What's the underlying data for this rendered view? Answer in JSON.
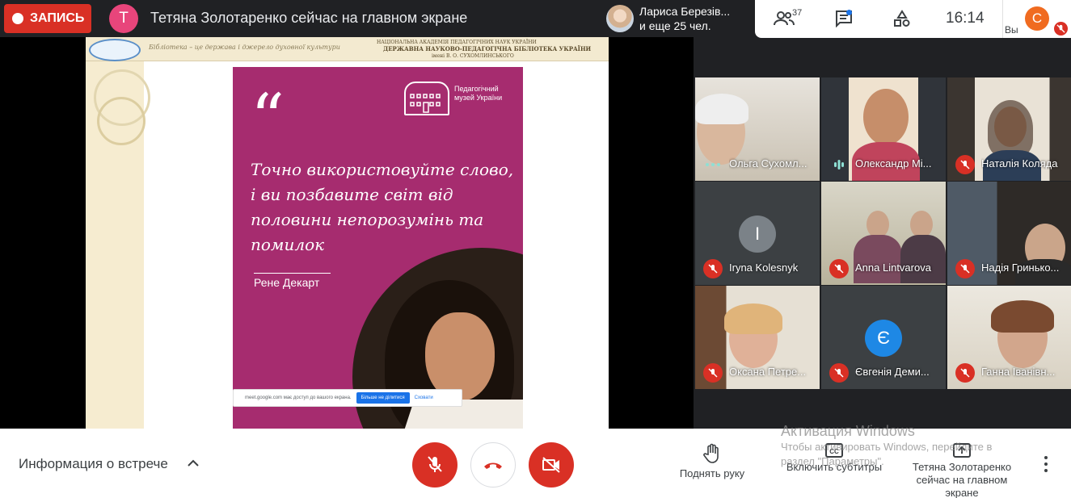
{
  "recording": {
    "label": "ЗАПИСЬ",
    "color": "#d93025"
  },
  "presenter": {
    "initial": "Т",
    "avatar_color": "#e8457b",
    "status": "Тетяна Золотаренко сейчас на главном экране"
  },
  "attendees": {
    "name": "Лариса Березів...",
    "more": "и еще 25 чел."
  },
  "toolbar": {
    "people_icon": "people-icon",
    "people_count": "37",
    "chat_icon": "chat-icon",
    "activities_icon": "activities-icon",
    "time": "16:14",
    "self_initial": "С",
    "self_avatar_color": "#f06b20",
    "self_label": "Вы"
  },
  "slide": {
    "slogan": "Бібліотека – це держава і джерело духовної культури",
    "academy_line1": "НАЦІОНАЛЬНА АКАДЕМІЯ ПЕДАГОГІЧНИХ НАУК УКРАЇНИ",
    "academy_line2": "ДЕРЖАВНА НАУКОВО-ПЕДАГОГІЧНА БІБЛІОТЕКА УКРАЇНИ",
    "academy_line3": "імені В. О. СУХОМЛИНСЬКОГО",
    "museum_name": "Педагогічний музей України",
    "quote_marks": "“",
    "quote": "Точно використовуйте слово, і ви позбавите світ від половини непорозумінь та помилок",
    "author": "Рене Декарт",
    "card_color": "#a62c6f"
  },
  "share_bar": {
    "text": "meet.google.com має доступ до вашого екрана.",
    "stop_label": "Більше не ділитися",
    "hide_label": "Сховати"
  },
  "participants": [
    {
      "name": "Ольга Сухомл...",
      "mic": "speaking-dots"
    },
    {
      "name": "Олександр Мі...",
      "mic": "speaking-bars"
    },
    {
      "name": "Наталія Коляда",
      "mic": "muted"
    },
    {
      "name": "Iryna Kolesnyk",
      "mic": "muted",
      "initial": "I",
      "avatar_color": "#7b8288"
    },
    {
      "name": "Anna Lintvarova",
      "mic": "muted"
    },
    {
      "name": "Надія Гринько...",
      "mic": "muted"
    },
    {
      "name": "Оксана Петре...",
      "mic": "muted"
    },
    {
      "name": "Євгенія Деми...",
      "mic": "muted",
      "initial": "Є",
      "avatar_color": "#1e88e5"
    },
    {
      "name": "Ганна Іванівн...",
      "mic": "muted"
    }
  ],
  "bottom": {
    "meeting_info": "Информация о встрече",
    "raise_hand": "Поднять руку",
    "captions": "Включить субтитры",
    "presenting": "Тетяна Золотаренко сейчас на главном экране"
  },
  "watermark": {
    "title": "Активация Windows",
    "line1": "Чтобы активировать Windows, перейдите в",
    "line2": "раздел \"Параметры\"."
  }
}
